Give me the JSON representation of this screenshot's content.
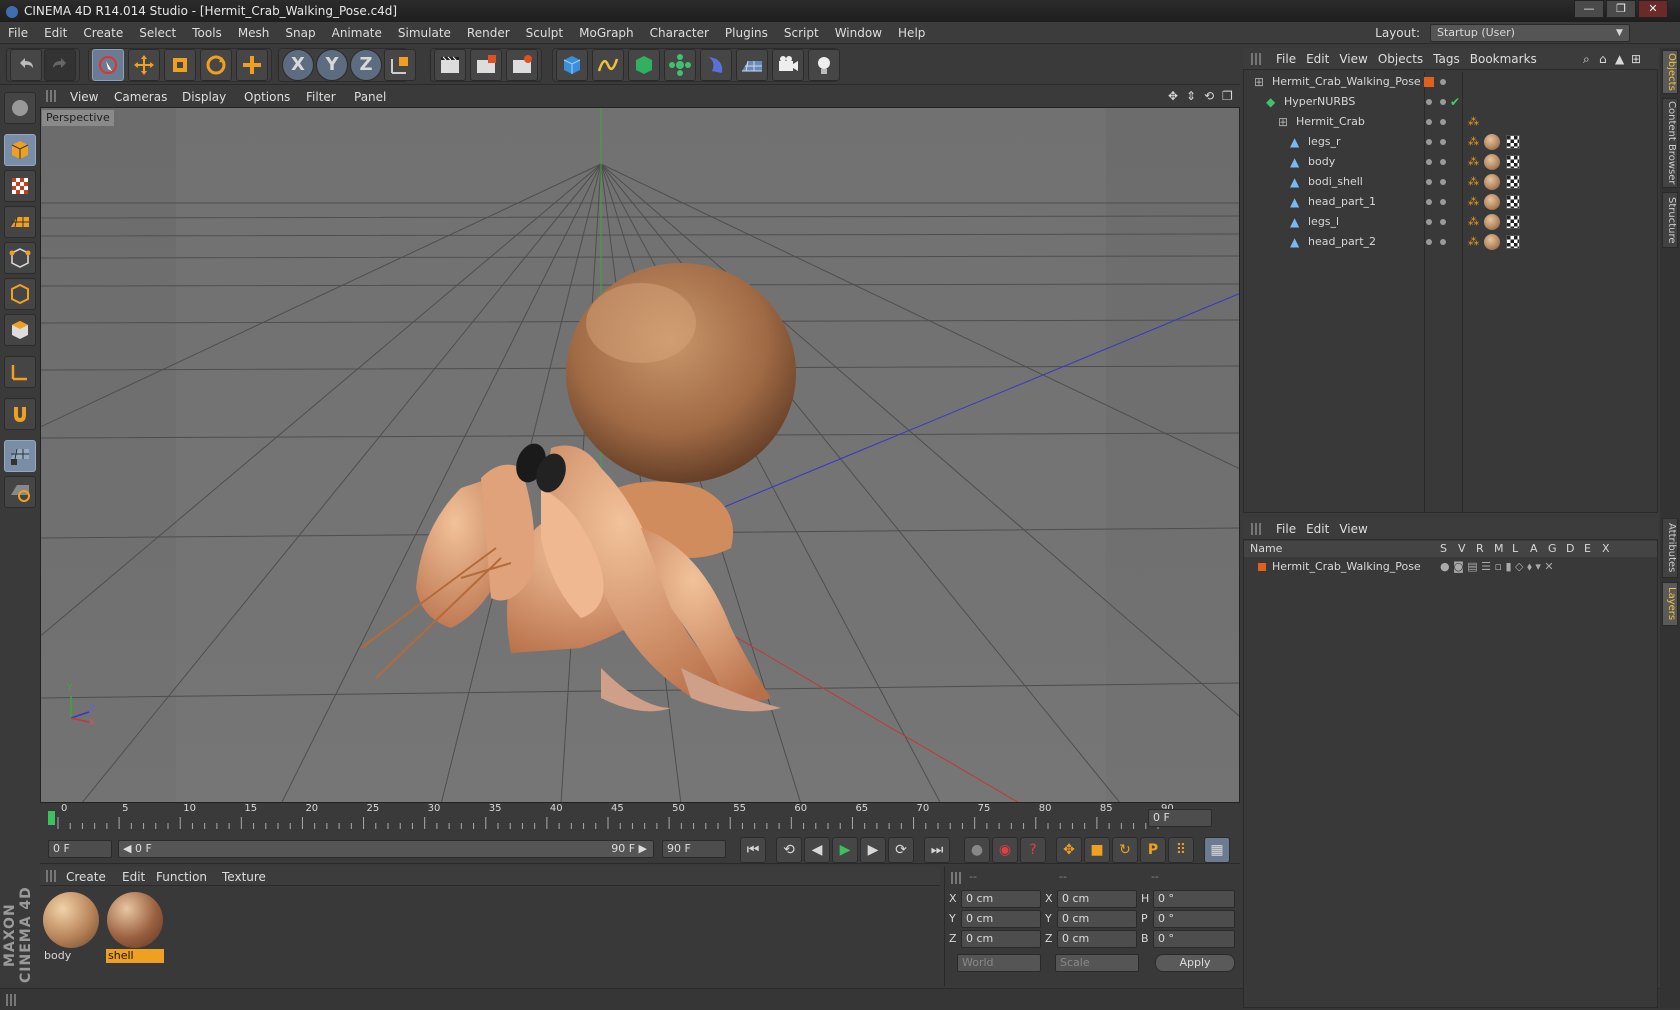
{
  "window": {
    "title": "CINEMA 4D R14.014 Studio - [Hermit_Crab_Walking_Pose.c4d]",
    "buttons": [
      "—",
      "❐",
      "✕"
    ]
  },
  "menubar": [
    "File",
    "Edit",
    "Create",
    "Select",
    "Tools",
    "Mesh",
    "Snap",
    "Animate",
    "Simulate",
    "Render",
    "Sculpt",
    "MoGraph",
    "Character",
    "Plugins",
    "Script",
    "Window",
    "Help"
  ],
  "layout": {
    "label": "Layout:",
    "value": "Startup (User)"
  },
  "toolbar": {
    "undo_icon": "undo-icon",
    "redo_icon": "redo-icon",
    "axis_x": "X",
    "axis_y": "Y",
    "axis_z": "Z"
  },
  "viewport": {
    "menu": [
      "View",
      "Cameras",
      "Display",
      "Options",
      "Filter",
      "Panel"
    ],
    "label": "Perspective",
    "axis_labels": {
      "y": "Y",
      "z": "Z",
      "x": "X"
    }
  },
  "timeline": {
    "ticks": [
      "0",
      "5",
      "10",
      "15",
      "20",
      "25",
      "30",
      "35",
      "40",
      "45",
      "50",
      "55",
      "60",
      "65",
      "70",
      "75",
      "80",
      "85",
      "90"
    ],
    "current_frame": "0 F"
  },
  "transport": {
    "start_field": "0 F",
    "range_start": "◀ 0 F",
    "range_end": "90 F ▶",
    "end_field": "90 F"
  },
  "materials": {
    "menu": [
      "Create",
      "Edit",
      "Function",
      "Texture"
    ],
    "items": [
      {
        "name": "body",
        "selected": false
      },
      {
        "name": "shell",
        "selected": true
      }
    ]
  },
  "coords": {
    "headers": [
      "--",
      "--",
      "--"
    ],
    "rows": [
      {
        "a": "X",
        "av": "0 cm",
        "b": "X",
        "bv": "0 cm",
        "c": "H",
        "cv": "0 °"
      },
      {
        "a": "Y",
        "av": "0 cm",
        "b": "Y",
        "bv": "0 cm",
        "c": "P",
        "cv": "0 °"
      },
      {
        "a": "Z",
        "av": "0 cm",
        "b": "Z",
        "bv": "0 cm",
        "c": "B",
        "cv": "0 °"
      }
    ],
    "mode1": "World",
    "mode2": "Scale",
    "apply": "Apply"
  },
  "objects": {
    "menu": [
      "File",
      "Edit",
      "View",
      "Objects",
      "Tags",
      "Bookmarks"
    ],
    "tree": [
      {
        "name": "Hermit_Crab_Walking_Pose",
        "level": 0,
        "type": "null"
      },
      {
        "name": "HyperNURBS",
        "level": 1,
        "type": "nurbs"
      },
      {
        "name": "Hermit_Crab",
        "level": 2,
        "type": "null"
      },
      {
        "name": "legs_r",
        "level": 3,
        "type": "poly"
      },
      {
        "name": "body",
        "level": 3,
        "type": "poly"
      },
      {
        "name": "bodi_shell",
        "level": 3,
        "type": "poly"
      },
      {
        "name": "head_part_1",
        "level": 3,
        "type": "poly"
      },
      {
        "name": "legs_l",
        "level": 3,
        "type": "poly"
      },
      {
        "name": "head_part_2",
        "level": 3,
        "type": "poly"
      }
    ]
  },
  "layers": {
    "menu": [
      "File",
      "Edit",
      "View"
    ],
    "columns": [
      "Name",
      "S",
      "V",
      "R",
      "M",
      "L",
      "A",
      "G",
      "D",
      "E",
      "X"
    ],
    "rows": [
      {
        "name": "Hermit_Crab_Walking_Pose"
      }
    ]
  },
  "side_tabs": [
    "Objects",
    "Content Browser",
    "Structure",
    "Attributes",
    "Layers"
  ],
  "brand": "MAXON CINEMA 4D",
  "colors": {
    "accent": "#f0a020",
    "selection": "#e8a020",
    "x_axis": "#c04040",
    "z_axis": "#4040c0",
    "y_axis": "#40c040"
  }
}
